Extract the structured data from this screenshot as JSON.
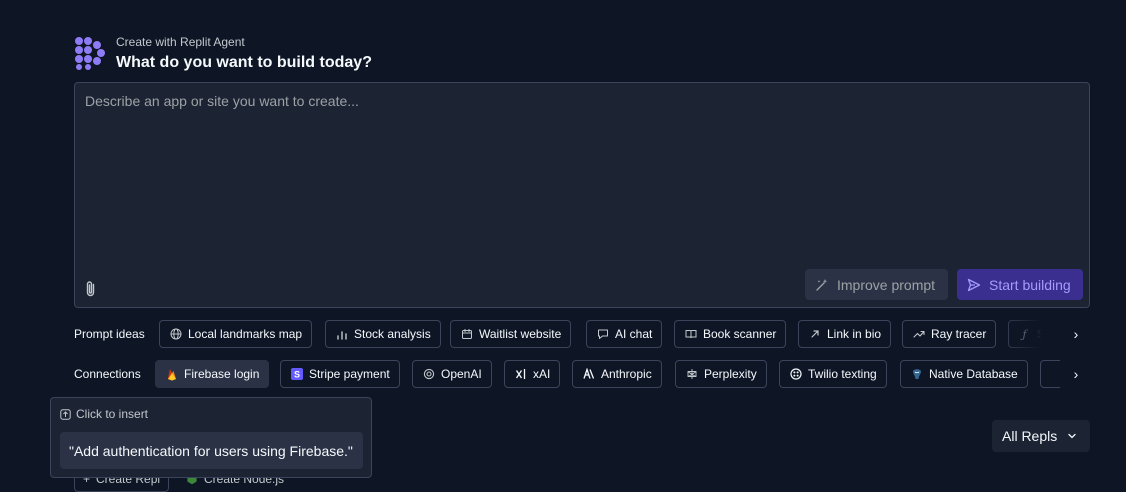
{
  "header": {
    "subtitle": "Create with Replit Agent",
    "title": "What do you want to build today?"
  },
  "prompt": {
    "placeholder": "Describe an app or site you want to create...",
    "value": ""
  },
  "actions": {
    "improve_label": "Improve prompt",
    "start_label": "Start building"
  },
  "prompt_ideas": {
    "label": "Prompt ideas",
    "items": [
      {
        "label": "Local landmarks map",
        "icon": "globe-icon"
      },
      {
        "label": "Stock analysis",
        "icon": "bar-chart-icon"
      },
      {
        "label": "Waitlist website",
        "icon": "calendar-icon"
      },
      {
        "label": "AI chat",
        "icon": "chat-icon"
      },
      {
        "label": "Book scanner",
        "icon": "book-icon"
      },
      {
        "label": "Link in bio",
        "icon": "link-icon"
      },
      {
        "label": "Ray tracer",
        "icon": "trend-icon"
      },
      {
        "label": "St",
        "icon": "function-icon"
      }
    ]
  },
  "connections": {
    "label": "Connections",
    "items": [
      {
        "label": "Firebase login",
        "icon": "firebase-icon"
      },
      {
        "label": "Stripe payment",
        "icon": "stripe-icon"
      },
      {
        "label": "OpenAI",
        "icon": "openai-icon"
      },
      {
        "label": "xAI",
        "icon": "xai-icon"
      },
      {
        "label": "Anthropic",
        "icon": "anthropic-icon"
      },
      {
        "label": "Perplexity",
        "icon": "perplexity-icon"
      },
      {
        "label": "Twilio texting",
        "icon": "twilio-icon"
      },
      {
        "label": "Native Database",
        "icon": "database-icon"
      }
    ]
  },
  "tooltip": {
    "header": "Click to insert",
    "text": "\"Add authentication for users using Firebase.\""
  },
  "repls": {
    "filter_label": "All Repls",
    "create_repl_label": "Create Repl",
    "create_node_label": "Create Node.js"
  },
  "colors": {
    "background": "#0e1525",
    "surface": "#1c2333",
    "border": "#3c445c",
    "accent": "#3a2f8f",
    "accent_text": "#a39bff",
    "brand_logo": "#8e7cf6"
  }
}
